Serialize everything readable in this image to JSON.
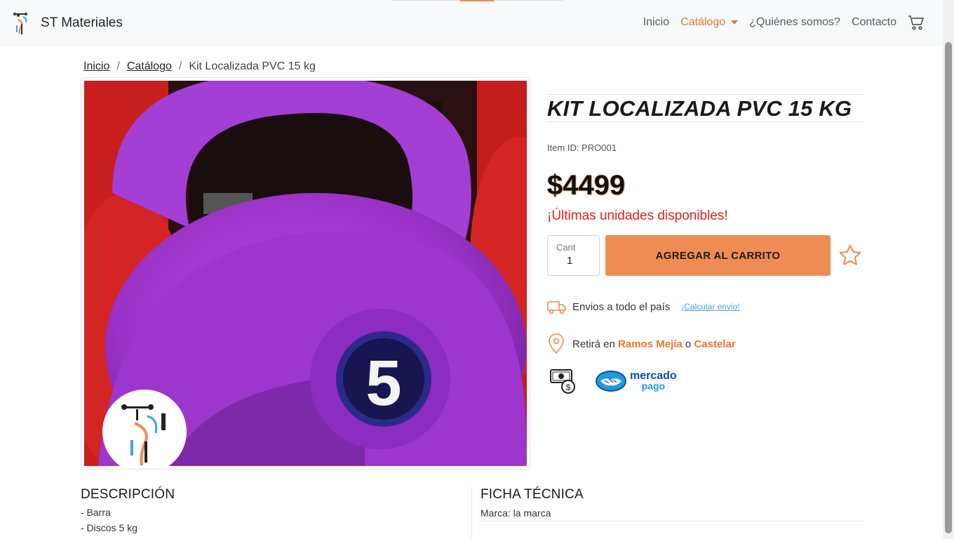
{
  "navbar": {
    "brand": "ST Materiales",
    "links": [
      "Inicio",
      "Catálogo",
      "¿Quiénes somos?",
      "Contacto"
    ],
    "active_link": "Catálogo",
    "accent_color": "#e8772e"
  },
  "breadcrumb": {
    "items": [
      "Inicio",
      "Catálogo",
      "Kit Localizada PVC 15 kg"
    ]
  },
  "product": {
    "title": "KIT LOCALIZADA PVC 15 KG",
    "item_id": "Item ID: PRO001",
    "price": "$4499",
    "stock_message": "¡Últimas unidades disponibles!",
    "quantity_label": "Cant",
    "quantity_value": "1",
    "add_button": "AGREGAR AL CARRITO",
    "kettlebell_number": "5"
  },
  "shipping": {
    "text": "Envios a todo el país",
    "link": "¡Calcular envio!"
  },
  "pickup": {
    "prefix": "Retirá en",
    "place1": "Ramos Mejía",
    "connector": "o",
    "place2": "Castelar"
  },
  "payment": {
    "mp_line1": "mercado",
    "mp_line2": "pago"
  },
  "description": {
    "title": "DESCRIPCIÓN",
    "lines": [
      "- Barra",
      "- Discos 5 kg"
    ]
  },
  "ficha": {
    "title": "FICHA TÉCNICA",
    "rows": [
      "Marca: la marca"
    ]
  },
  "colors": {
    "accent": "#ef8b55",
    "stock": "#e02020",
    "link": "#4aa3d8"
  },
  "icons": [
    "brand-logo-icon",
    "cart-icon",
    "star-icon",
    "truck-icon",
    "location-pin-icon",
    "cash-icon",
    "mercado-pago-icon"
  ]
}
